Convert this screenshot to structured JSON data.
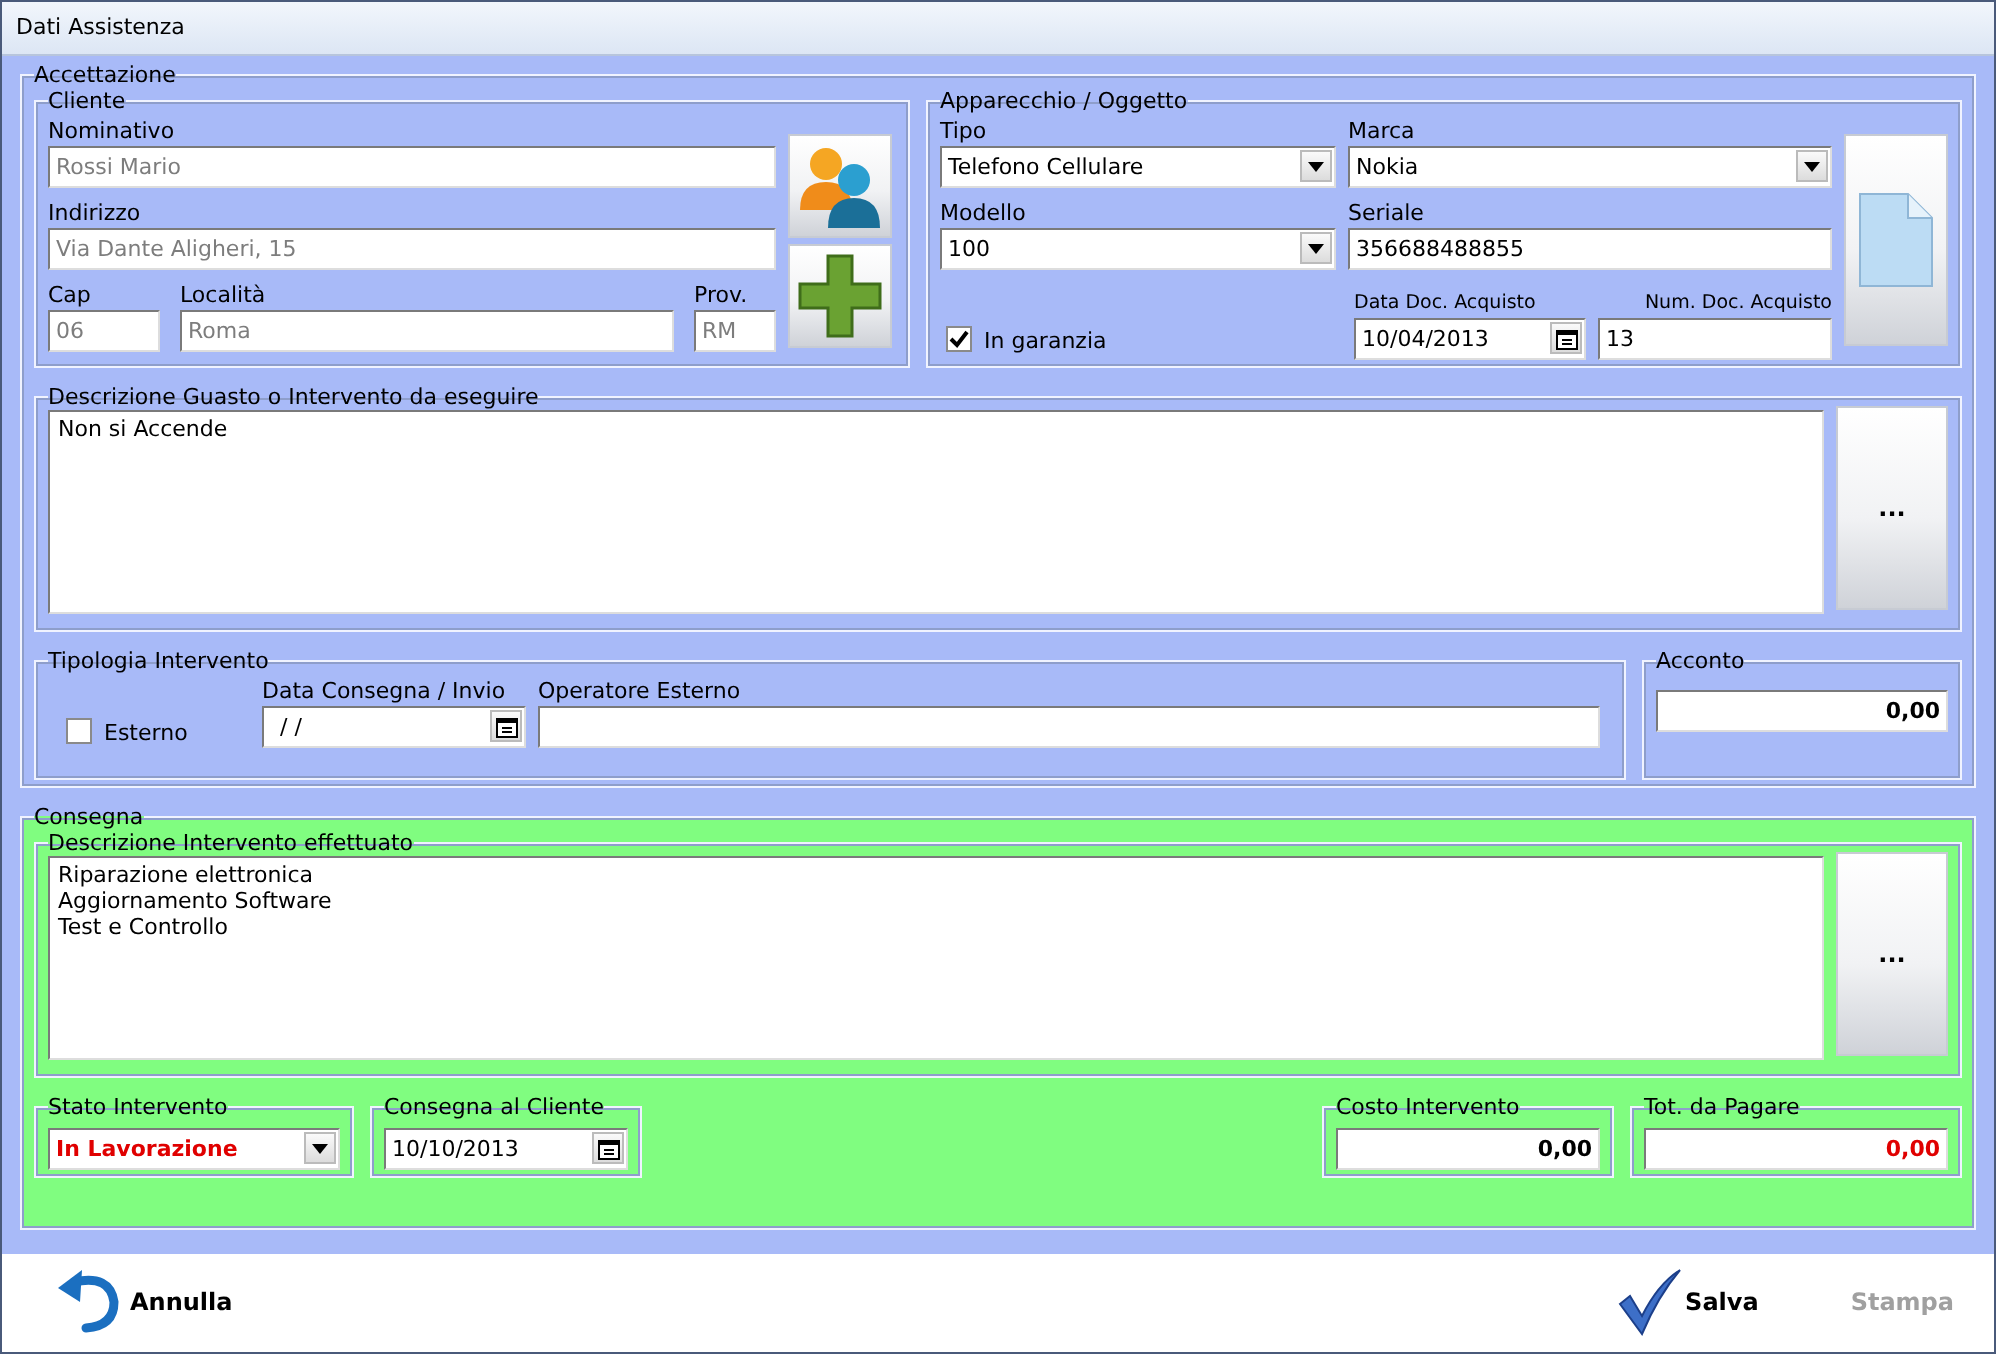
{
  "window": {
    "title": "Dati Assistenza"
  },
  "accettazione": {
    "title": "Accettazione"
  },
  "cliente": {
    "title": "Cliente",
    "fields": [
      {
        "label": "Nominativo",
        "value": "Rossi Mario",
        "disabled": true
      },
      {
        "label": "Indirizzo",
        "value": "Via Dante Aligheri, 15",
        "disabled": true
      },
      {
        "label": "Cap",
        "value": "06",
        "disabled": true
      },
      {
        "label": "Località",
        "value": "Roma",
        "disabled": true
      },
      {
        "label": "Prov.",
        "value": "RM",
        "disabled": true
      }
    ]
  },
  "apparecchio": {
    "title": "Apparecchio / Oggetto",
    "tipo": {
      "label": "Tipo",
      "value": "Telefono Cellulare"
    },
    "marca": {
      "label": "Marca",
      "value": "Nokia"
    },
    "modello": {
      "label": "Modello",
      "value": "100"
    },
    "seriale": {
      "label": "Seriale",
      "value": "356688488855"
    },
    "garanzia": {
      "label": "In garanzia",
      "checked": true
    },
    "data_doc": {
      "label": "Data Doc. Acquisto",
      "value": "10/04/2013"
    },
    "num_doc": {
      "label": "Num. Doc. Acquisto",
      "value": "13"
    }
  },
  "descrizione_guasto": {
    "title": "Descrizione Guasto o Intervento da eseguire",
    "text": "Non si Accende",
    "button": "..."
  },
  "tipologia": {
    "title": "Tipologia Intervento",
    "esterno": {
      "label": "Esterno",
      "checked": false
    },
    "data_consegna": {
      "label": "Data Consegna / Invio",
      "value": "/ /"
    },
    "operatore": {
      "label": "Operatore Esterno"
    }
  },
  "acconto": {
    "title": "Acconto",
    "value": "0,00"
  },
  "consegna": {
    "title": "Consegna",
    "descrizione": {
      "title": "Descrizione Intervento effettuato",
      "text": "Riparazione elettronica\nAggiornamento Software\nTest e Controllo",
      "button": "..."
    },
    "stato": {
      "title": "Stato Intervento",
      "value": "In Lavorazione"
    },
    "consegna_cliente": {
      "title": "Consegna al Cliente",
      "value": "10/10/2013"
    },
    "costo": {
      "title": "Costo Intervento",
      "value": "0,00"
    },
    "totale": {
      "title": "Tot. da Pagare",
      "value": "0,00"
    }
  },
  "footer": {
    "buttons": [
      {
        "label": "Annulla",
        "kind": "cancel",
        "disabled": false
      },
      {
        "label": "Salva",
        "kind": "save",
        "disabled": false
      },
      {
        "label": "Stampa",
        "kind": "print",
        "disabled": true
      }
    ]
  }
}
